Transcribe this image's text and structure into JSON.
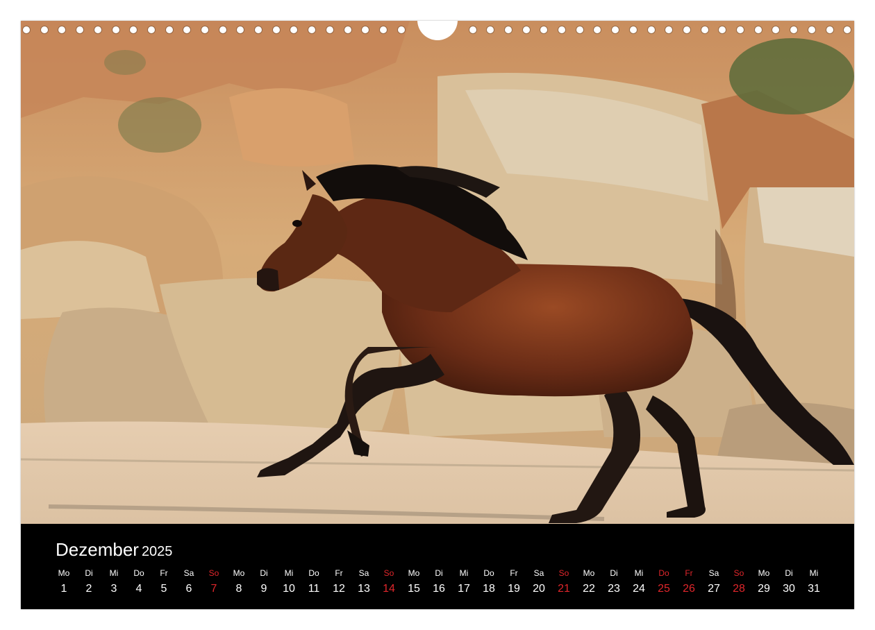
{
  "calendar": {
    "month": "Dezember",
    "year": "2025",
    "days": [
      {
        "weekday": "Mo",
        "day": "1",
        "red": false
      },
      {
        "weekday": "Di",
        "day": "2",
        "red": false
      },
      {
        "weekday": "Mi",
        "day": "3",
        "red": false
      },
      {
        "weekday": "Do",
        "day": "4",
        "red": false
      },
      {
        "weekday": "Fr",
        "day": "5",
        "red": false
      },
      {
        "weekday": "Sa",
        "day": "6",
        "red": false
      },
      {
        "weekday": "So",
        "day": "7",
        "red": true
      },
      {
        "weekday": "Mo",
        "day": "8",
        "red": false
      },
      {
        "weekday": "Di",
        "day": "9",
        "red": false
      },
      {
        "weekday": "Mi",
        "day": "10",
        "red": false
      },
      {
        "weekday": "Do",
        "day": "11",
        "red": false
      },
      {
        "weekday": "Fr",
        "day": "12",
        "red": false
      },
      {
        "weekday": "Sa",
        "day": "13",
        "red": false
      },
      {
        "weekday": "So",
        "day": "14",
        "red": true
      },
      {
        "weekday": "Mo",
        "day": "15",
        "red": false
      },
      {
        "weekday": "Di",
        "day": "16",
        "red": false
      },
      {
        "weekday": "Mi",
        "day": "17",
        "red": false
      },
      {
        "weekday": "Do",
        "day": "18",
        "red": false
      },
      {
        "weekday": "Fr",
        "day": "19",
        "red": false
      },
      {
        "weekday": "Sa",
        "day": "20",
        "red": false
      },
      {
        "weekday": "So",
        "day": "21",
        "red": true
      },
      {
        "weekday": "Mo",
        "day": "22",
        "red": false
      },
      {
        "weekday": "Di",
        "day": "23",
        "red": false
      },
      {
        "weekday": "Mi",
        "day": "24",
        "red": false
      },
      {
        "weekday": "Do",
        "day": "25",
        "red": true
      },
      {
        "weekday": "Fr",
        "day": "26",
        "red": true
      },
      {
        "weekday": "Sa",
        "day": "27",
        "red": false
      },
      {
        "weekday": "So",
        "day": "28",
        "red": true
      },
      {
        "weekday": "Mo",
        "day": "29",
        "red": false
      },
      {
        "weekday": "Di",
        "day": "30",
        "red": false
      },
      {
        "weekday": "Mi",
        "day": "31",
        "red": false
      }
    ]
  },
  "colors": {
    "holiday": "#e0262b",
    "strip_background": "#000000",
    "text": "#ffffff"
  }
}
